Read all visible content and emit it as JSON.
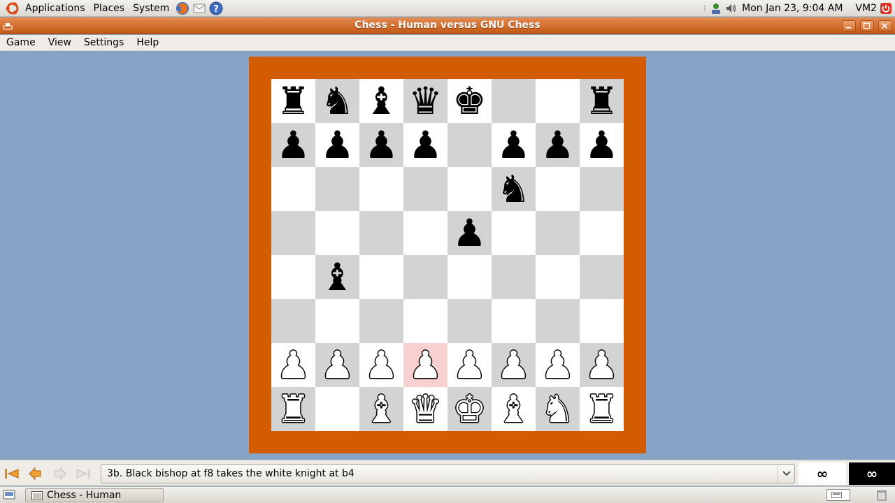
{
  "top_panel": {
    "menus": [
      "Applications",
      "Places",
      "System"
    ],
    "clock": "Mon Jan 23,  9:04 AM",
    "user": "VM2",
    "launcher_icons": [
      "firefox-icon",
      "mail-icon",
      "help-icon"
    ]
  },
  "window": {
    "title": "Chess - Human versus GNU Chess",
    "buttons": [
      "minimize",
      "maximize",
      "close"
    ]
  },
  "menubar": {
    "game": "Game",
    "view": "View",
    "settings": "Settings",
    "help": "Help"
  },
  "board": {
    "highlight_square": "d2",
    "ranks": [
      [
        "br",
        "bn",
        "bb",
        "bq",
        "bk",
        "",
        "",
        "br"
      ],
      [
        "bp",
        "bp",
        "bp",
        "bp",
        "",
        "bp",
        "bp",
        "bp"
      ],
      [
        "",
        "",
        "",
        "",
        "",
        "bn",
        "",
        ""
      ],
      [
        "",
        "",
        "",
        "",
        "bp",
        "",
        "",
        ""
      ],
      [
        "",
        "bb",
        "",
        "",
        "",
        "",
        "",
        ""
      ],
      [
        "",
        "",
        "",
        "",
        "",
        "",
        "",
        ""
      ],
      [
        "wp",
        "wp",
        "wp",
        "wp",
        "wp",
        "wp",
        "wp",
        "wp"
      ],
      [
        "wr",
        "",
        "wb",
        "wq",
        "wk",
        "wb",
        "wn",
        "wr"
      ]
    ]
  },
  "history": {
    "current_move": "3b. Black bishop at f8 takes the white knight at b4",
    "white_clock": "∞",
    "black_clock": "∞"
  },
  "taskbar": {
    "task_label": "Chess - Human versus..."
  },
  "colors": {
    "board_frame": "#d45c00",
    "light_square": "#ffffff",
    "dark_square": "#d3d3d3",
    "highlight": "#f8d0d0",
    "background": "#86a4c5"
  }
}
